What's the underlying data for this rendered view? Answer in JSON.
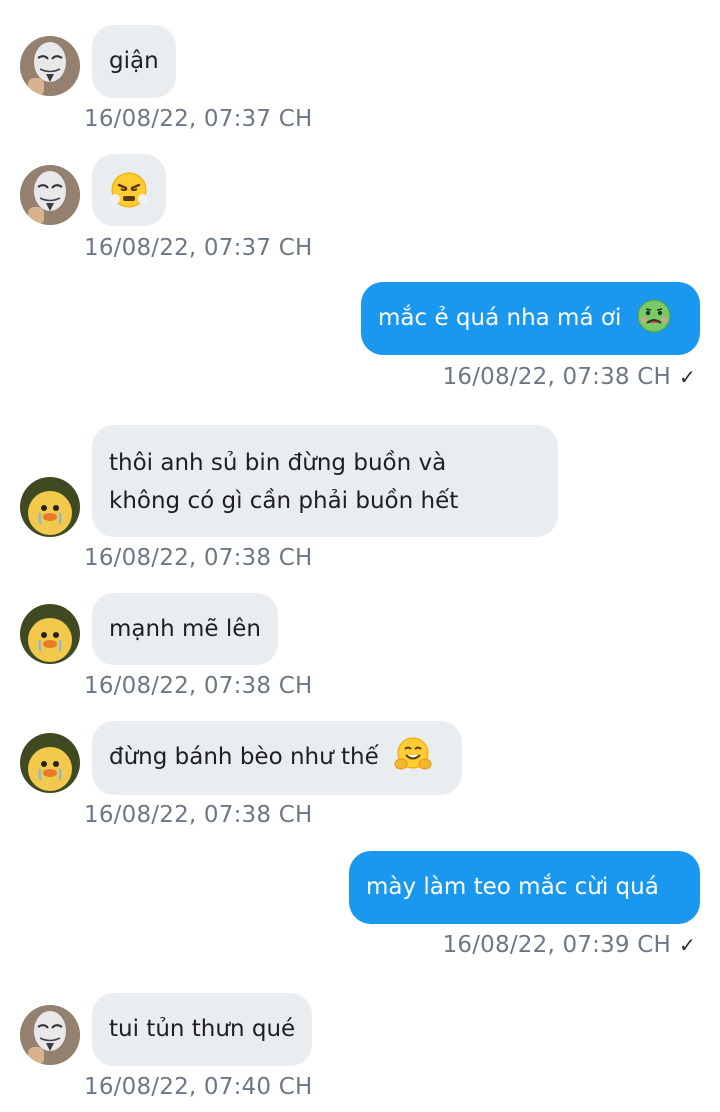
{
  "colors": {
    "incoming_bubble": "#e9edf0",
    "outgoing_bubble": "#1a98f0",
    "timestamp": "#6c7886"
  },
  "messages": [
    {
      "direction": "in",
      "avatar": "mask-avatar",
      "text": "giận",
      "time": "16/08/22,  07:37 CH"
    },
    {
      "direction": "in",
      "avatar": "mask-avatar",
      "sticker": "huffing-face-emoji",
      "time": "16/08/22,  07:37 CH"
    },
    {
      "direction": "out",
      "text": "mắc ẻ quá nha má ơi",
      "sticker": "nauseated-face-emoji",
      "time": "16/08/22,  07:38 CH",
      "status": "✓"
    },
    {
      "direction": "in",
      "avatar": "duckling-avatar",
      "lines": [
        "thôi anh sủ bin đừng buồn và",
        "không có gì cần phải buồn hết"
      ],
      "time": "16/08/22,  07:38 CH"
    },
    {
      "direction": "in",
      "avatar": "duckling-avatar",
      "text": "mạnh mẽ lên",
      "time": "16/08/22,  07:38 CH"
    },
    {
      "direction": "in",
      "avatar": "duckling-avatar",
      "text": "đừng bánh bèo như thế",
      "sticker": "hugging-face-emoji",
      "time": "16/08/22,  07:38 CH"
    },
    {
      "direction": "out",
      "text": "mày làm teo mắc cừi quá",
      "time": "16/08/22,  07:39 CH",
      "status": "✓"
    },
    {
      "direction": "in",
      "avatar": "mask-avatar",
      "text": "tui tủn thưn qué",
      "time": "16/08/22,  07:40 CH"
    }
  ]
}
